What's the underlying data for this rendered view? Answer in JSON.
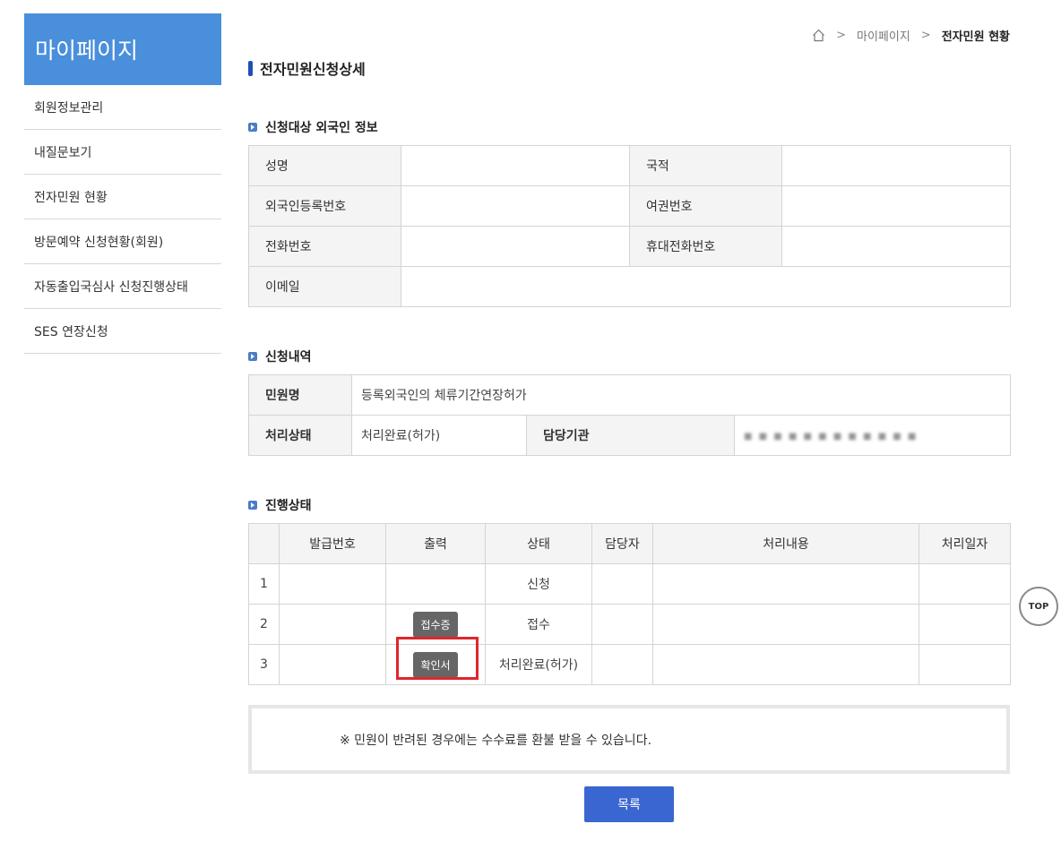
{
  "sidebar": {
    "title": "마이페이지",
    "items": [
      {
        "label": "회원정보관리"
      },
      {
        "label": "내질문보기"
      },
      {
        "label": "전자민원 현황"
      },
      {
        "label": "방문예약 신청현황(회원)"
      },
      {
        "label": "자동출입국심사 신청진행상태"
      },
      {
        "label": "SES 연장신청"
      }
    ]
  },
  "breadcrumb": {
    "items": [
      "마이페이지",
      "전자민원 현황"
    ]
  },
  "page": {
    "title": "전자민원신청상세"
  },
  "foreigner_info": {
    "section_title": "신청대상 외국인 정보",
    "labels": {
      "name": "성명",
      "nationality": "국적",
      "reg_number": "외국인등록번호",
      "passport": "여권번호",
      "phone": "전화번호",
      "mobile": "휴대전화번호",
      "email": "이메일"
    }
  },
  "request": {
    "section_title": "신청내역",
    "labels": {
      "civil_name": "민원명",
      "status": "처리상태",
      "agency": "담당기관"
    },
    "values": {
      "civil_name": "등록외국인의 체류기간연장허가",
      "status": "처리완료(허가)",
      "agency": "■ ■ ■ ■ ■ ■ ■ ■ ■ ■ ■ ■"
    }
  },
  "progress": {
    "section_title": "진행상태",
    "headers": [
      "",
      "발급번호",
      "출력",
      "상태",
      "담당자",
      "처리내용",
      "처리일자"
    ],
    "rows": [
      {
        "num": "1",
        "print": "",
        "status": "신청"
      },
      {
        "num": "2",
        "print": "접수증",
        "status": "접수"
      },
      {
        "num": "3",
        "print": "확인서",
        "status": "처리완료(허가)"
      }
    ]
  },
  "notice": {
    "text": "※ 민원이 반려된 경우에는 수수료를 환불 받을 수 있습니다."
  },
  "buttons": {
    "list": "목록",
    "top": "TOP"
  },
  "colors": {
    "sidebar_header": "#4a8fdb",
    "title_bar": "#1d4fb7",
    "list_button": "#3a66d1",
    "highlight": "#e0262b"
  }
}
